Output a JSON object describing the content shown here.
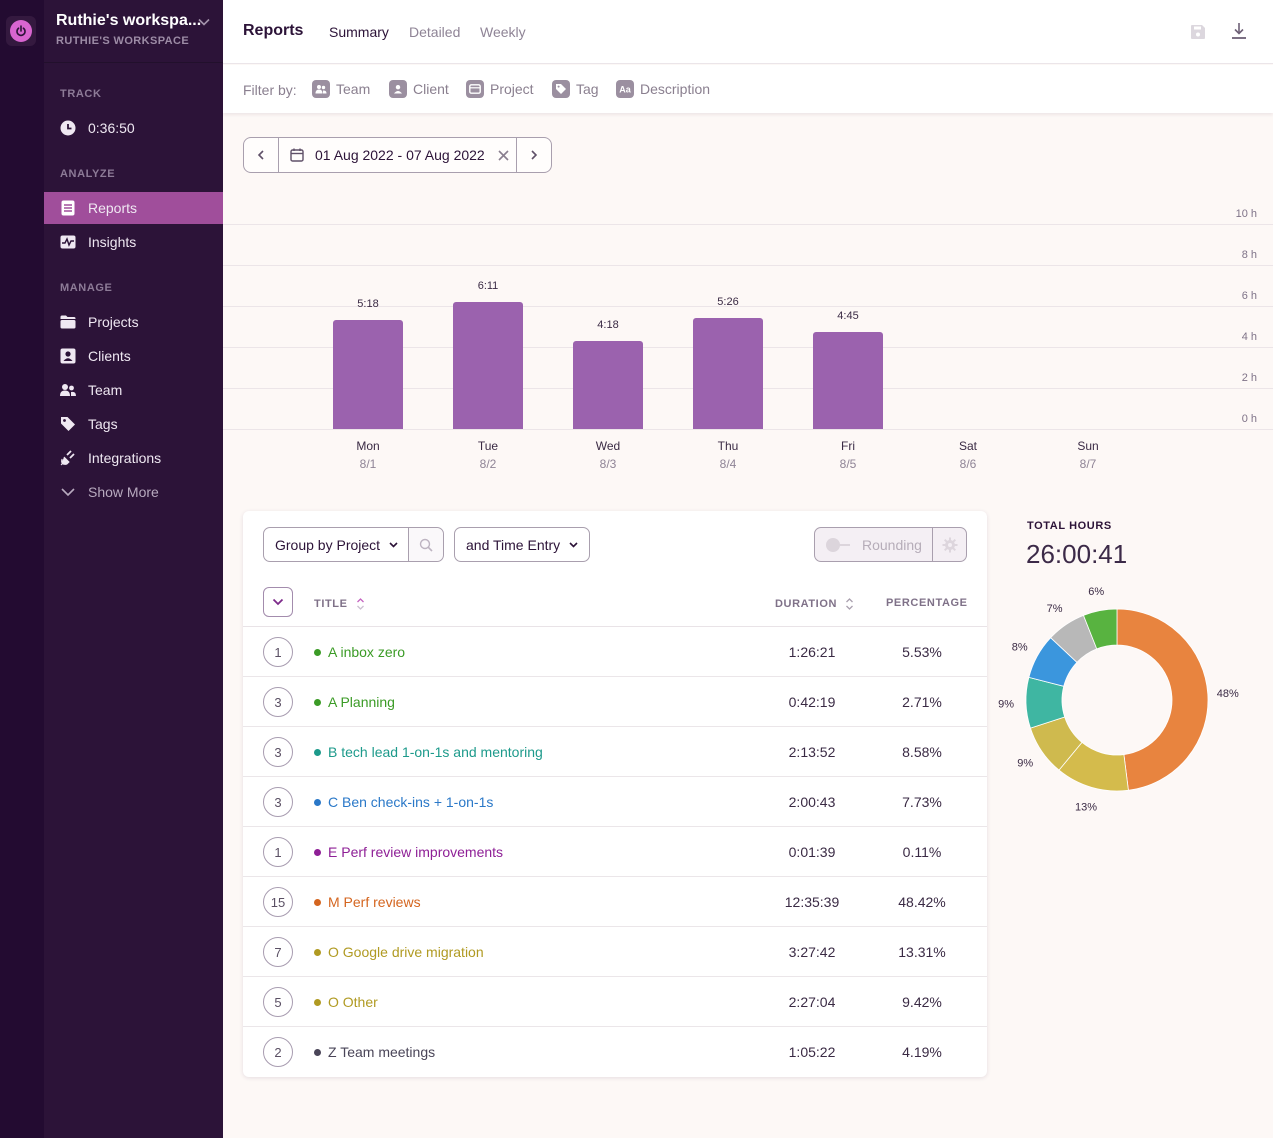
{
  "workspace": {
    "title": "Ruthie's workspa...",
    "subtitle": "RUTHIE'S WORKSPACE"
  },
  "sidebar": {
    "track_label": "TRACK",
    "timer": "0:36:50",
    "analyze_label": "ANALYZE",
    "manage_label": "MANAGE",
    "items": [
      {
        "label": "Reports",
        "icon": "reports-icon",
        "active": true
      },
      {
        "label": "Insights",
        "icon": "insights-icon"
      },
      {
        "label": "Projects",
        "icon": "folder-icon"
      },
      {
        "label": "Clients",
        "icon": "client-icon"
      },
      {
        "label": "Team",
        "icon": "team-icon"
      },
      {
        "label": "Tags",
        "icon": "tag-icon"
      },
      {
        "label": "Integrations",
        "icon": "plug-icon"
      },
      {
        "label": "Show More",
        "icon": "chevron-down-icon"
      }
    ]
  },
  "header": {
    "title": "Reports",
    "tabs": [
      {
        "label": "Summary",
        "active": true
      },
      {
        "label": "Detailed"
      },
      {
        "label": "Weekly"
      }
    ]
  },
  "filters": {
    "label": "Filter by:",
    "items": [
      "Team",
      "Client",
      "Project",
      "Tag",
      "Description"
    ]
  },
  "date_range": {
    "value": "01 Aug 2022 - 07 Aug 2022"
  },
  "chart_data": [
    {
      "type": "bar",
      "title": "",
      "categories": [
        "Mon",
        "Tue",
        "Wed",
        "Thu",
        "Fri",
        "Sat",
        "Sun"
      ],
      "dates": [
        "8/1",
        "8/2",
        "8/3",
        "8/4",
        "8/5",
        "8/6",
        "8/7"
      ],
      "values": [
        5.3,
        6.1833,
        4.3,
        5.4333,
        4.75,
        0,
        0
      ],
      "value_labels": [
        "5:18",
        "6:11",
        "4:18",
        "5:26",
        "4:45",
        "",
        ""
      ],
      "ylabel": "hours",
      "ylim": [
        0,
        10
      ],
      "yticks": [
        "10 h",
        "8 h",
        "6 h",
        "4 h",
        "2 h",
        "0 h"
      ],
      "grid": true,
      "bar_color": "#9b62ae"
    },
    {
      "type": "pie",
      "title": "TOTAL HOURS",
      "total": "26:00:41",
      "slices": [
        {
          "label": "48%",
          "value": 48,
          "color": "#e8843f"
        },
        {
          "label": "13%",
          "value": 13,
          "color": "#d4bb4c"
        },
        {
          "label": "9%",
          "value": 9,
          "color": "#cfba4e"
        },
        {
          "label": "9%",
          "value": 9,
          "color": "#3fb6a2"
        },
        {
          "label": "8%",
          "value": 8,
          "color": "#3b96dd"
        },
        {
          "label": "7%",
          "value": 7,
          "color": "#b8b8b8"
        },
        {
          "label": "6%",
          "value": 6,
          "color": "#58b340"
        }
      ]
    }
  ],
  "table": {
    "group_by": "Group by Project",
    "sub_group": "and Time Entry",
    "rounding_label": "Rounding",
    "columns": {
      "title": "TITLE",
      "duration": "DURATION",
      "percentage": "PERCENTAGE"
    },
    "rows": [
      {
        "count": "1",
        "title": "A inbox zero",
        "color": "#3b9b26",
        "duration": "1:26:21",
        "percentage": "5.53%"
      },
      {
        "count": "3",
        "title": "A Planning",
        "color": "#3b9b26",
        "duration": "0:42:19",
        "percentage": "2.71%"
      },
      {
        "count": "3",
        "title": "B tech lead 1-on-1s and mentoring",
        "color": "#1d9a8b",
        "duration": "2:13:52",
        "percentage": "8.58%"
      },
      {
        "count": "3",
        "title": "C Ben check-ins + 1-on-1s",
        "color": "#2a78c8",
        "duration": "2:00:43",
        "percentage": "7.73%"
      },
      {
        "count": "1",
        "title": "E Perf review improvements",
        "color": "#8e1f96",
        "duration": "0:01:39",
        "percentage": "0.11%"
      },
      {
        "count": "15",
        "title": "M Perf reviews",
        "color": "#d4651f",
        "duration": "12:35:39",
        "percentage": "48.42%"
      },
      {
        "count": "7",
        "title": "O Google drive migration",
        "color": "#b09a22",
        "duration": "3:27:42",
        "percentage": "13.31%"
      },
      {
        "count": "5",
        "title": "O Other",
        "color": "#b09a22",
        "duration": "2:27:04",
        "percentage": "9.42%"
      },
      {
        "count": "2",
        "title": "Z Team meetings",
        "color": "#4a4558",
        "duration": "1:05:22",
        "percentage": "4.19%"
      }
    ]
  },
  "colors": {
    "sidebar_bg": "#2c1338",
    "strip_bg": "#230b31",
    "accent": "#a04e9b",
    "page_bg": "#fdf8f6"
  }
}
